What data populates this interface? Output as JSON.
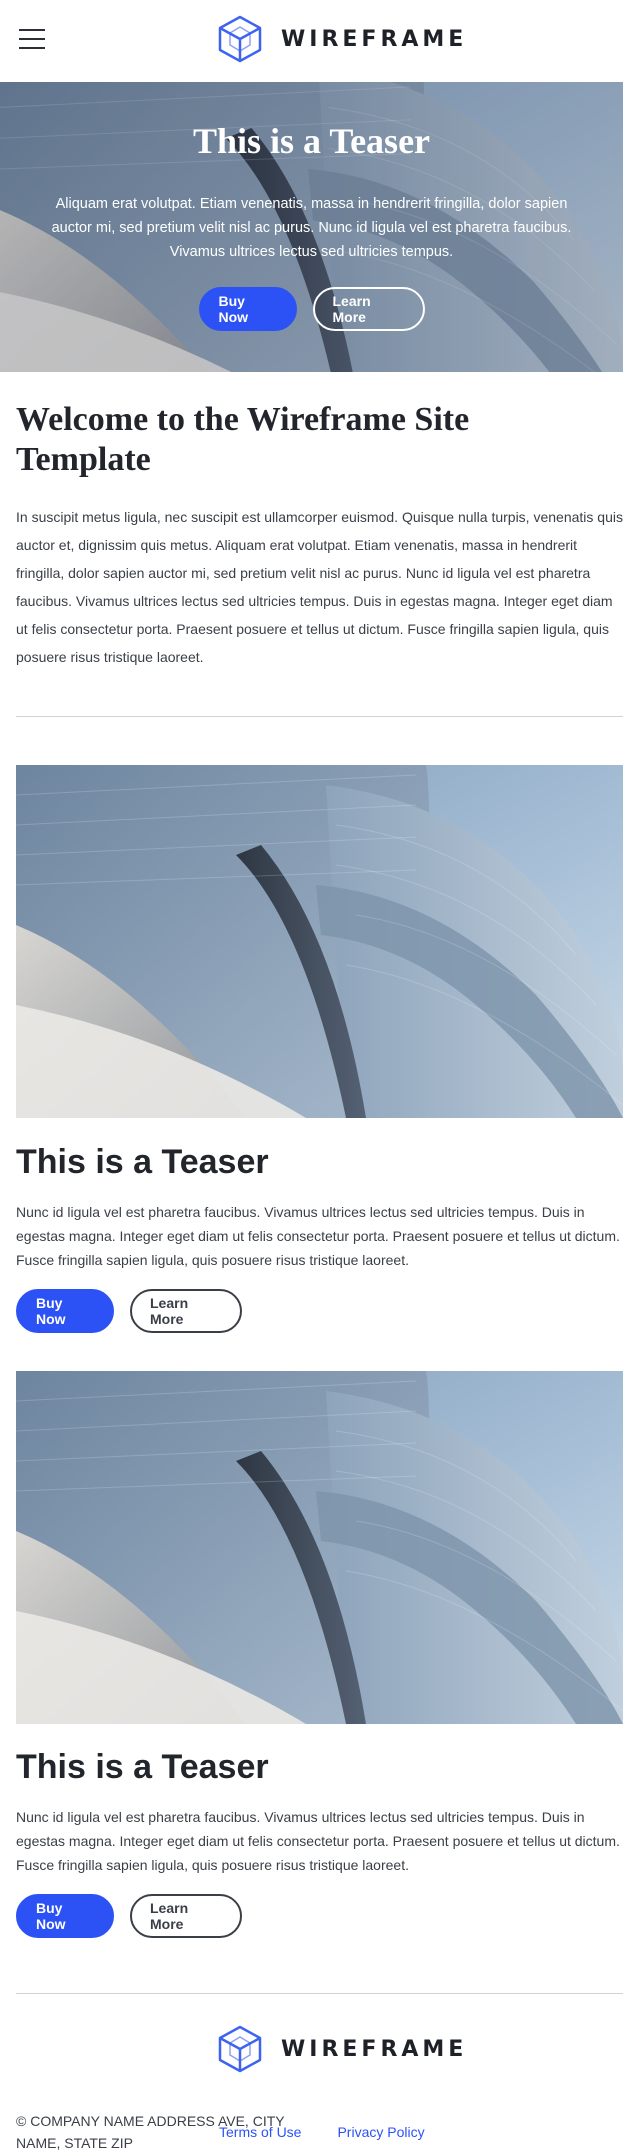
{
  "header": {
    "menu_icon": "hamburger-menu-icon",
    "logo_icon": "wireframe-cube-icon",
    "logo_text": "WIREFRAME"
  },
  "hero": {
    "title": "This is a Teaser",
    "text": "Aliquam erat volutpat. Etiam venenatis, massa in hendrerit fringilla, dolor sapien auctor mi, sed pretium velit nisl ac purus. Nunc id ligula vel est pharetra faucibus. Vivamus ultrices lectus sed ultricies tempus.",
    "primary_button": "Buy Now",
    "secondary_button": "Learn More"
  },
  "welcome": {
    "title": "Welcome to the Wireframe Site Template",
    "body": "In suscipit metus ligula, nec suscipit est ullamcorper euismod. Quisque nulla turpis, venenatis quis auctor et, dignissim quis metus. Aliquam erat volutpat. Etiam venenatis, massa in hendrerit fringilla, dolor sapien auctor mi, sed pretium velit nisl ac purus. Nunc id ligula vel est pharetra faucibus. Vivamus ultrices lectus sed ultricies tempus. Duis in egestas magna. Integer eget diam ut felis consectetur porta. Praesent posuere et tellus ut dictum. Fusce fringilla sapien ligula, quis posuere risus tristique laoreet."
  },
  "teasers": [
    {
      "title": "This is a Teaser",
      "body": "Nunc id ligula vel est pharetra faucibus. Vivamus ultrices lectus sed ultricies tempus. Duis in egestas magna. Integer eget diam ut felis consectetur porta. Praesent posuere et tellus ut dictum. Fusce fringilla sapien ligula, quis posuere risus tristique laoreet.",
      "primary_button": "Buy Now",
      "secondary_button": "Learn More"
    },
    {
      "title": "This is a Teaser",
      "body": "Nunc id ligula vel est pharetra faucibus. Vivamus ultrices lectus sed ultricies tempus. Duis in egestas magna. Integer eget diam ut felis consectetur porta. Praesent posuere et tellus ut dictum. Fusce fringilla sapien ligula, quis posuere risus tristique laoreet.",
      "primary_button": "Buy Now",
      "secondary_button": "Learn More"
    }
  ],
  "footer": {
    "logo_text": "WIREFRAME",
    "address": "© Company Name Address Ave, City Name, State Zip",
    "links": [
      "Terms of Use",
      "Privacy Policy"
    ]
  },
  "colors": {
    "accent": "#2c52f5",
    "text": "#3a3f47",
    "heading": "#22262c",
    "logo_blue": "#3f63f0"
  }
}
